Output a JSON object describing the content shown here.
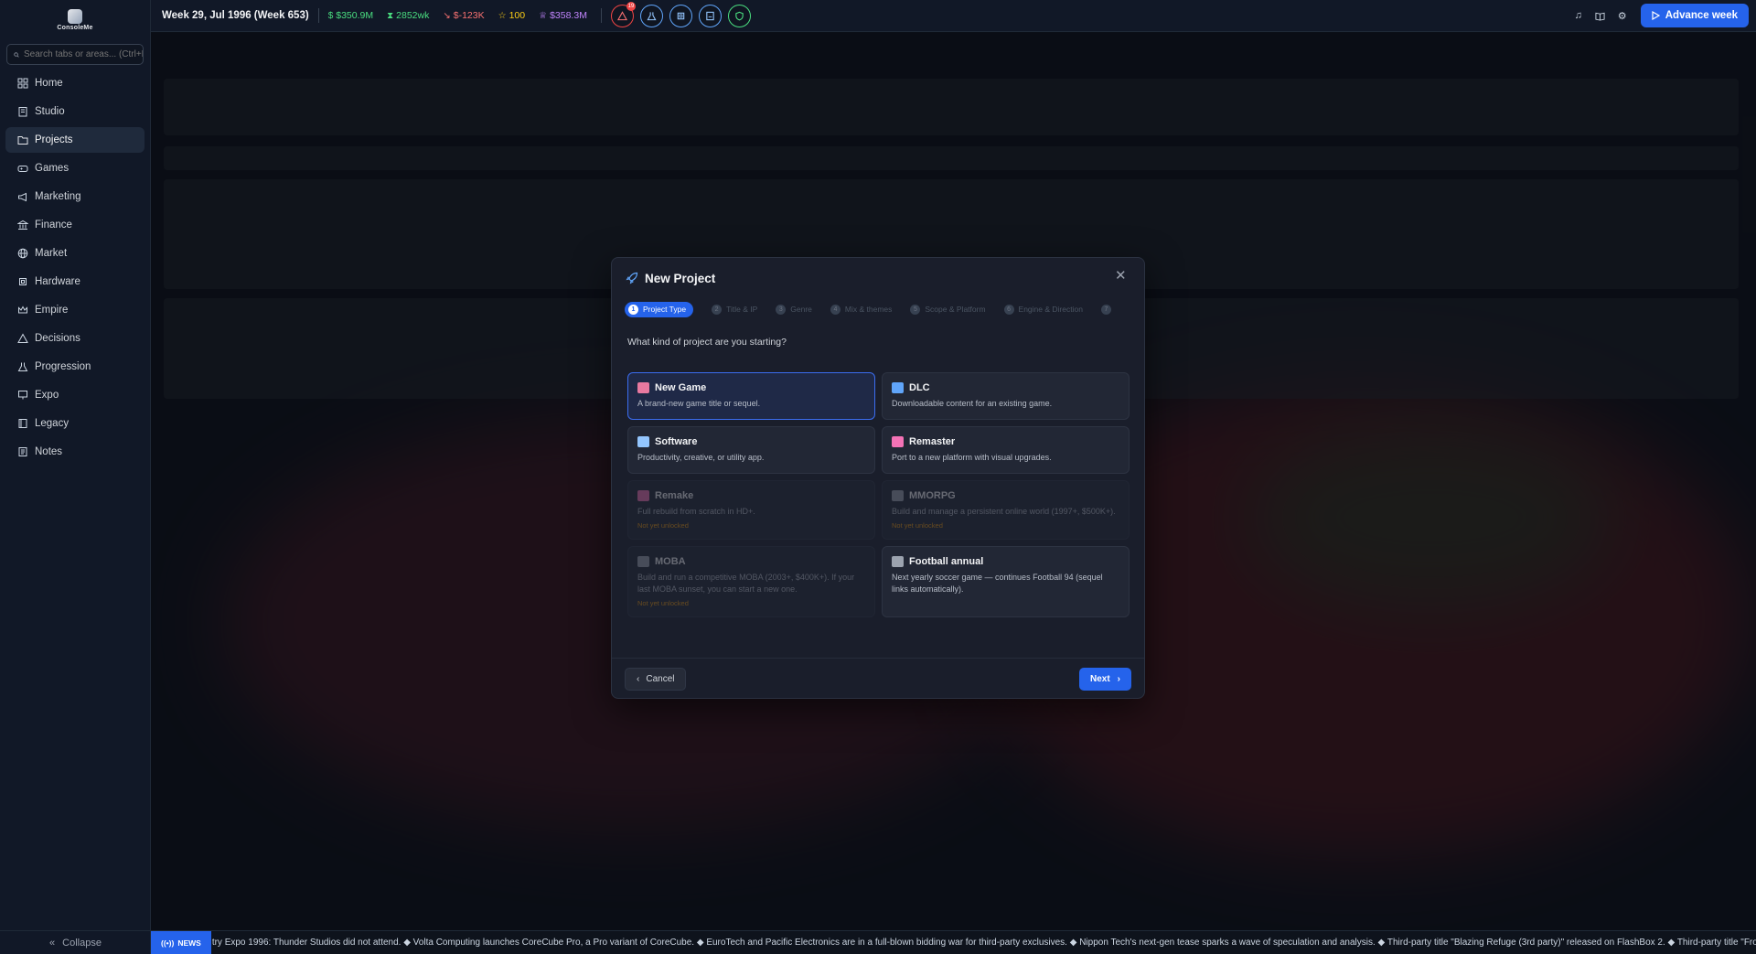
{
  "app": {
    "logo_text": "ConsoleMe"
  },
  "sidebar": {
    "search_placeholder": "Search tabs or areas... (Ctrl+K)",
    "items": [
      {
        "label": "Home",
        "icon": "grid-icon"
      },
      {
        "label": "Studio",
        "icon": "building-icon"
      },
      {
        "label": "Projects",
        "icon": "folder-icon",
        "active": true
      },
      {
        "label": "Games",
        "icon": "gamepad-icon"
      },
      {
        "label": "Marketing",
        "icon": "megaphone-icon"
      },
      {
        "label": "Finance",
        "icon": "bank-icon"
      },
      {
        "label": "Market",
        "icon": "globe-icon"
      },
      {
        "label": "Hardware",
        "icon": "hardware-icon"
      },
      {
        "label": "Empire",
        "icon": "crown-icon"
      },
      {
        "label": "Decisions",
        "icon": "alert-triangle-icon"
      },
      {
        "label": "Progression",
        "icon": "flask-icon"
      },
      {
        "label": "Expo",
        "icon": "presentation-icon"
      },
      {
        "label": "Legacy",
        "icon": "book-icon"
      },
      {
        "label": "Notes",
        "icon": "notes-icon"
      }
    ],
    "collapse_label": "Collapse"
  },
  "topbar": {
    "week": "Week 29, Jul 1996 (Week 653)",
    "cash": "$350.9M",
    "weekly": "2852wk",
    "delta": "$-123K",
    "reputation": "100",
    "valuation": "$358.3M",
    "alert_count": "19",
    "advance_label": "Advance week"
  },
  "modal": {
    "title": "New Project",
    "steps": [
      {
        "num": "1",
        "label": "Project Type"
      },
      {
        "num": "2",
        "label": "Title & IP"
      },
      {
        "num": "3",
        "label": "Genre"
      },
      {
        "num": "4",
        "label": "Mix & themes"
      },
      {
        "num": "5",
        "label": "Scope & Platform"
      },
      {
        "num": "6",
        "label": "Engine & Direction"
      },
      {
        "num": "7",
        "label": ""
      }
    ],
    "question": "What kind of project are you starting?",
    "cards": [
      {
        "title": "New Game",
        "desc": "A brand-new game title or sequel.",
        "lock": "",
        "color": "#e879a0"
      },
      {
        "title": "DLC",
        "desc": "Downloadable content for an existing game.",
        "lock": "",
        "color": "#60a5fa"
      },
      {
        "title": "Software",
        "desc": "Productivity, creative, or utility app.",
        "lock": "",
        "color": "#93c5fd"
      },
      {
        "title": "Remaster",
        "desc": "Port to a new platform with visual upgrades.",
        "lock": "",
        "color": "#f472b6"
      },
      {
        "title": "Remake",
        "desc": "Full rebuild from scratch in HD+.",
        "lock": "Not yet unlocked",
        "color": "#f472b6"
      },
      {
        "title": "MMORPG",
        "desc": "Build and manage a persistent online world (1997+, $500K+).",
        "lock": "Not yet unlocked",
        "color": "#9ca3af"
      },
      {
        "title": "MOBA",
        "desc": "Build and run a competitive MOBA (2003+, $400K+). If your last MOBA sunset, you can start a new one.",
        "lock": "Not yet unlocked",
        "color": "#9ca3af"
      },
      {
        "title": "Football annual",
        "desc": "Next yearly soccer game — continues Football 94 (sequel links automatically).",
        "lock": "",
        "color": "#9ca3af"
      }
    ],
    "cancel_label": "Cancel",
    "next_label": "Next"
  },
  "news": {
    "badge": "NEWS",
    "text": "try Expo 1996: Thunder Studios did not attend. ◆ Volta Computing launches CoreCube Pro, a Pro variant of CoreCube. ◆ EuroTech and Pacific Electronics are in a full-blown bidding war for third-party exclusives. ◆ Nippon Tech's next-gen tease sparks a wave of speculation and analysis. ◆ Third-party title \"Blazing Refuge (3rd party)\" released on FlashBox 2. ◆ Third-party title \"Frozen Moon"
  },
  "colors": {
    "accent": "#2563eb",
    "cash": "#4ade80",
    "delta": "#f87171",
    "rep": "#facc15",
    "valuation": "#c084fc"
  }
}
